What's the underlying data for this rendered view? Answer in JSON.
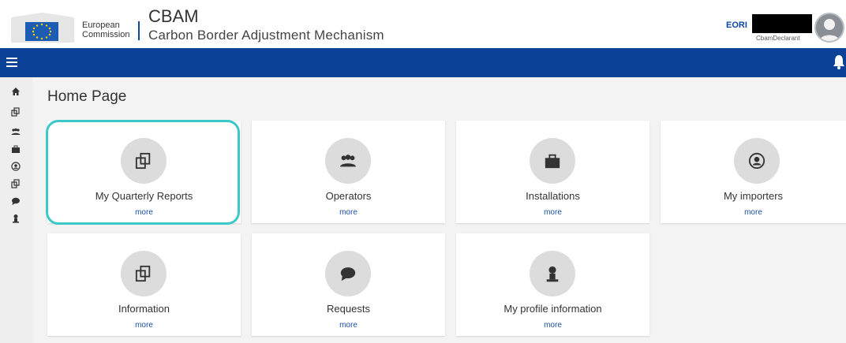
{
  "header": {
    "ec_line1": "European",
    "ec_line2": "Commission",
    "app_title": "CBAM",
    "app_subtitle": "Carbon Border Adjustment Mechanism",
    "eori_label": "EORI",
    "role": "CbamDeclarant"
  },
  "colors": {
    "brand_blue": "#0b4196",
    "highlight": "#3cc8c8",
    "link": "#1a4f9e"
  },
  "sidebar": {
    "items": [
      {
        "icon": "home-icon"
      },
      {
        "icon": "reports-icon"
      },
      {
        "icon": "users-icon"
      },
      {
        "icon": "briefcase-icon"
      },
      {
        "icon": "user-circle-icon"
      },
      {
        "icon": "reports-icon"
      },
      {
        "icon": "chat-icon"
      },
      {
        "icon": "person-icon"
      }
    ]
  },
  "main": {
    "title": "Home Page",
    "cards": [
      {
        "label": "My Quarterly Reports",
        "more": "more",
        "icon": "reports-icon"
      },
      {
        "label": "Operators",
        "more": "more",
        "icon": "users-icon"
      },
      {
        "label": "Installations",
        "more": "more",
        "icon": "briefcase-icon"
      },
      {
        "label": "My importers",
        "more": "more",
        "icon": "user-circle-icon"
      },
      {
        "label": "Information",
        "more": "more",
        "icon": "reports-icon"
      },
      {
        "label": "Requests",
        "more": "more",
        "icon": "chat-icon"
      },
      {
        "label": "My profile information",
        "more": "more",
        "icon": "person-icon"
      }
    ]
  }
}
